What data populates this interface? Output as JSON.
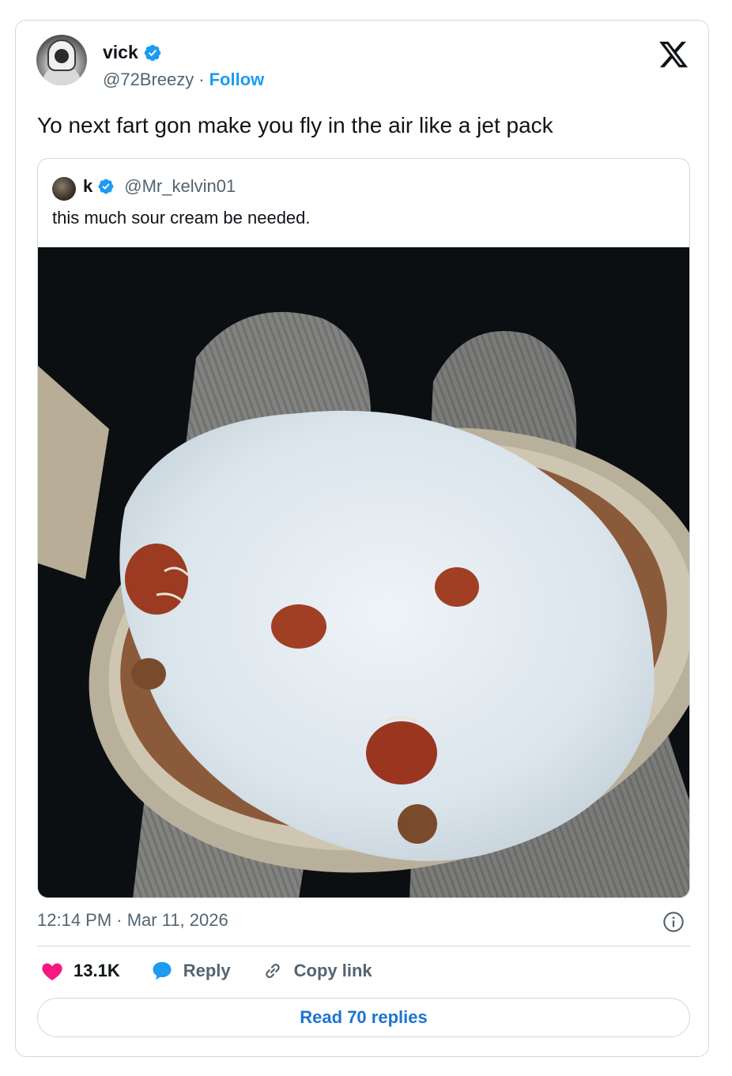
{
  "tweet": {
    "author": {
      "display_name": "vick",
      "handle": "@72Breezy",
      "separator": "·",
      "follow_label": "Follow",
      "verified": true
    },
    "text": "Yo next fart gon make you fly in the air like a jet pack",
    "timestamp": "12:14 PM · Mar 11, 2026"
  },
  "quoted_tweet": {
    "display_name": "k",
    "handle": "@Mr_kelvin01",
    "verified": true,
    "text": "this much sour cream be needed."
  },
  "actions": {
    "likes": "13.1K",
    "reply_label": "Reply",
    "copy_link_label": "Copy link"
  },
  "read_replies_label": "Read 70 replies",
  "icons": {
    "logo": "x-logo-icon",
    "verified": "verified-badge-icon",
    "info": "info-icon",
    "like": "heart-icon",
    "reply": "speech-bubble-icon",
    "copy": "link-icon"
  },
  "colors": {
    "accent": "#1d9bf0",
    "like": "#f91880",
    "muted_text": "#536471",
    "border": "#cfd9de"
  }
}
